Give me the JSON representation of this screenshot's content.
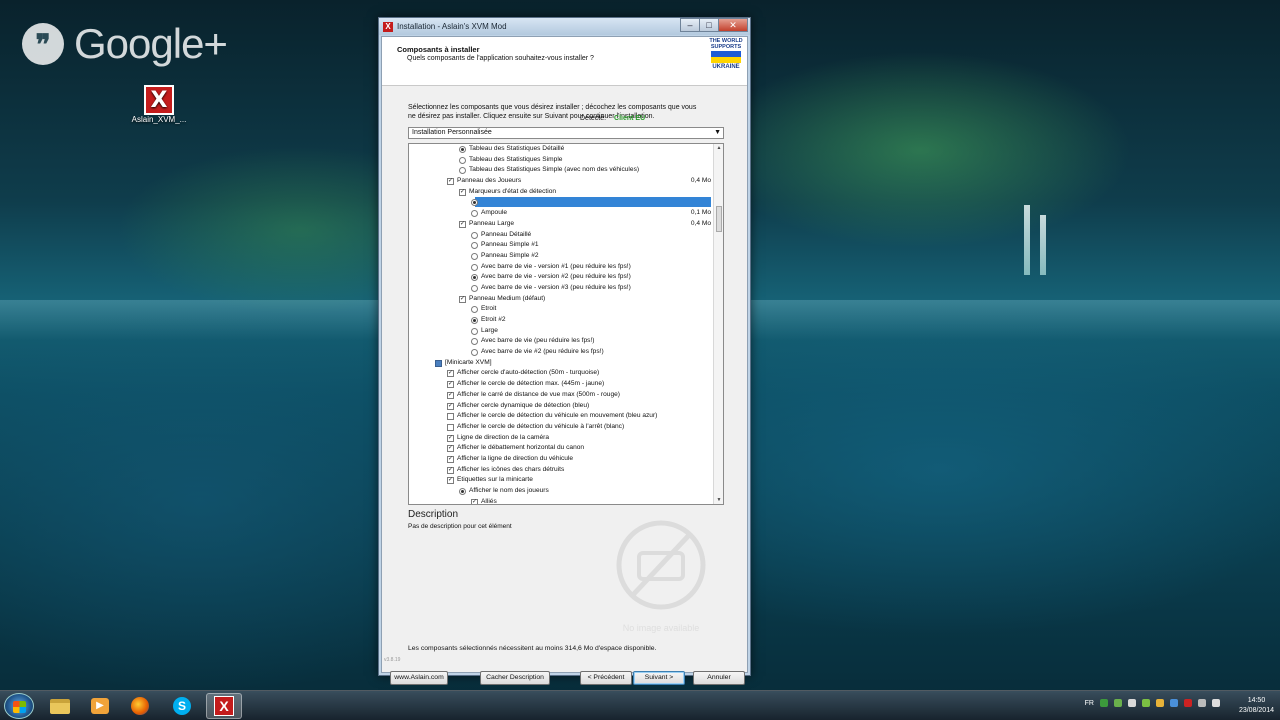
{
  "desktop": {
    "gplus_label": "Google+",
    "gplus_glyph": "❞",
    "icon_label": "Aslain_XVM_..."
  },
  "window": {
    "title": "Installation - Aslain's XVM Mod",
    "header_title": "Composants à installer",
    "header_subtitle": "Quels composants de l'application souhaitez-vous installer ?",
    "badge": {
      "line1": "THE WORLD",
      "line2": "SUPPORTS",
      "line3": "UKRAINE"
    },
    "instructions": "Sélectionnez les composants que vous désirez installer ; décochez les composants que vous ne désirez pas installer. Cliquez ensuite sur Suivant pour continuer l'installation.",
    "detected_label": "Détecté:",
    "detected_value": "Client EU",
    "install_type": "Installation Personnalisée",
    "description_title": "Description",
    "description_text": "Pas de description pour cet élément",
    "no_image_label": "No image available",
    "space_text": "Les composants sélectionnés nécessitent au moins 314,6 Mo d'espace disponible.",
    "version": "v3.8.19",
    "buttons": {
      "website": "www.Aslain.com",
      "hide_desc": "Cacher Description",
      "back": "< Précédent",
      "next": "Suivant >",
      "cancel": "Annuler"
    }
  },
  "tree": [
    {
      "label": "Tableau des Statistiques Détaillé",
      "type": "radio",
      "checked": true,
      "indent": 2,
      "size": ""
    },
    {
      "label": "Tableau des Statistiques Simple",
      "type": "radio",
      "checked": false,
      "indent": 2,
      "size": ""
    },
    {
      "label": "Tableau des Statistiques Simple (avec nom des véhicules)",
      "type": "radio",
      "checked": false,
      "indent": 2,
      "size": ""
    },
    {
      "label": "Panneau des Joueurs",
      "type": "check",
      "checked": true,
      "indent": 1,
      "size": "0,4 Mo"
    },
    {
      "label": "Marqueurs d'état de détection",
      "type": "check",
      "checked": true,
      "indent": 2,
      "size": ""
    },
    {
      "label": "",
      "type": "radio",
      "checked": true,
      "indent": 3,
      "size": "",
      "selected": true
    },
    {
      "label": "Ampoule",
      "type": "radio",
      "checked": false,
      "indent": 3,
      "size": "0,1 Mo"
    },
    {
      "label": "Panneau Large",
      "type": "check",
      "checked": true,
      "indent": 2,
      "size": "0,4 Mo"
    },
    {
      "label": "Panneau Détaillé",
      "type": "radio",
      "checked": false,
      "indent": 3,
      "size": ""
    },
    {
      "label": "Panneau Simple #1",
      "type": "radio",
      "checked": false,
      "indent": 3,
      "size": ""
    },
    {
      "label": "Panneau Simple #2",
      "type": "radio",
      "checked": false,
      "indent": 3,
      "size": ""
    },
    {
      "label": "Avec barre de vie - version #1 (peu réduire les fps!)",
      "type": "radio",
      "checked": false,
      "indent": 3,
      "size": ""
    },
    {
      "label": "Avec barre de vie - version #2 (peu réduire les fps!)",
      "type": "radio",
      "checked": true,
      "indent": 3,
      "size": ""
    },
    {
      "label": "Avec barre de vie - version #3 (peu réduire les fps!)",
      "type": "radio",
      "checked": false,
      "indent": 3,
      "size": ""
    },
    {
      "label": "Panneau Medium (défaut)",
      "type": "check",
      "checked": true,
      "indent": 2,
      "size": ""
    },
    {
      "label": "Etroit",
      "type": "radio",
      "checked": false,
      "indent": 3,
      "size": ""
    },
    {
      "label": "Etroit #2",
      "type": "radio",
      "checked": true,
      "indent": 3,
      "size": ""
    },
    {
      "label": "Large",
      "type": "radio",
      "checked": false,
      "indent": 3,
      "size": ""
    },
    {
      "label": "Avec barre de vie (peu réduire les fps!)",
      "type": "radio",
      "checked": false,
      "indent": 3,
      "size": ""
    },
    {
      "label": "Avec barre de vie #2 (peu réduire les fps!)",
      "type": "radio",
      "checked": false,
      "indent": 3,
      "size": ""
    },
    {
      "label": "[Minicarte XVM]",
      "type": "check",
      "partial": true,
      "indent": 0,
      "size": ""
    },
    {
      "label": "Afficher cercle d'auto-détection (50m - turquoise)",
      "type": "check",
      "checked": true,
      "indent": 1,
      "size": ""
    },
    {
      "label": "Afficher le cercle de détection max. (445m - jaune)",
      "type": "check",
      "checked": true,
      "indent": 1,
      "size": ""
    },
    {
      "label": "Afficher le carré de distance de vue max (500m - rouge)",
      "type": "check",
      "checked": true,
      "indent": 1,
      "size": ""
    },
    {
      "label": "Afficher cercle dynamique de détection (bleu)",
      "type": "check",
      "checked": true,
      "indent": 1,
      "size": ""
    },
    {
      "label": "Afficher le cercle de détection du véhicule en mouvement (bleu azur)",
      "type": "check",
      "checked": false,
      "indent": 1,
      "size": ""
    },
    {
      "label": "Afficher le cercle de détection du véhicule à l'arrêt (blanc)",
      "type": "check",
      "checked": false,
      "indent": 1,
      "size": ""
    },
    {
      "label": "Ligne de direction de la caméra",
      "type": "check",
      "checked": true,
      "indent": 1,
      "size": ""
    },
    {
      "label": "Afficher le débattement horizontal du canon",
      "type": "check",
      "checked": true,
      "indent": 1,
      "size": ""
    },
    {
      "label": "Afficher la ligne de direction du véhicule",
      "type": "check",
      "checked": true,
      "indent": 1,
      "size": ""
    },
    {
      "label": "Afficher les icônes des chars détruits",
      "type": "check",
      "checked": true,
      "indent": 1,
      "size": ""
    },
    {
      "label": "Etiquettes sur la minicarte",
      "type": "check",
      "checked": true,
      "indent": 1,
      "size": ""
    },
    {
      "label": "Afficher le nom des joueurs",
      "type": "radio",
      "checked": true,
      "indent": 2,
      "size": ""
    },
    {
      "label": "Alliés",
      "type": "check",
      "checked": true,
      "indent": 3,
      "size": ""
    }
  ],
  "taskbar": {
    "lang": "FR",
    "time": "14:50",
    "date": "23/08/2014"
  }
}
